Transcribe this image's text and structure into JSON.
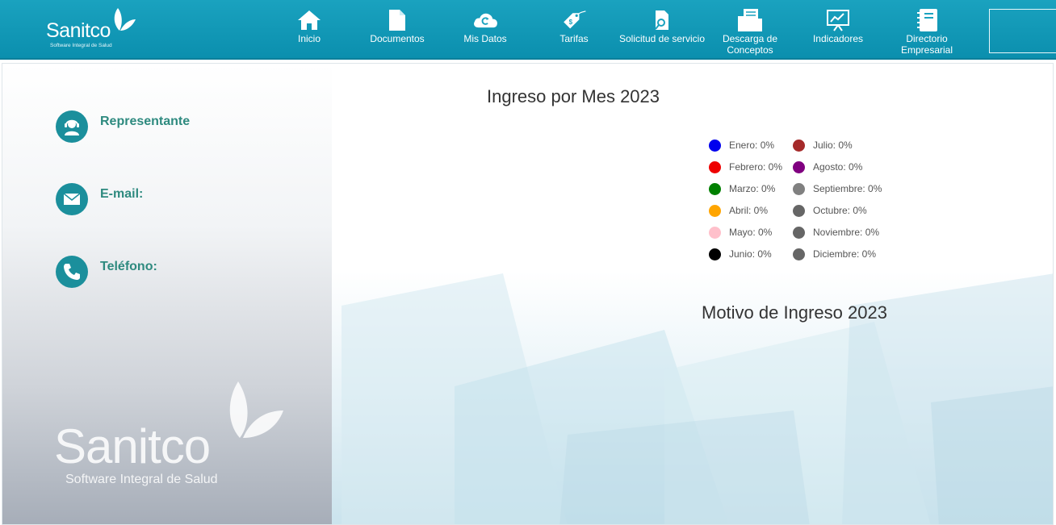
{
  "brand": {
    "name": "Sanitco",
    "tagline": "Software Integral de Salud"
  },
  "nav": {
    "items": [
      {
        "label": "Inicio",
        "icon": "home-icon"
      },
      {
        "label": "Documentos",
        "icon": "document-icon"
      },
      {
        "label": "Mis Datos",
        "icon": "cloud-refresh-icon"
      },
      {
        "label": "Tarifas",
        "icon": "price-tag-icon"
      },
      {
        "label": "Solicitud de servicio",
        "icon": "document-search-icon"
      },
      {
        "label": "Descarga de Conceptos",
        "icon": "folder-download-icon"
      },
      {
        "label": "Indicadores",
        "icon": "presentation-chart-icon"
      },
      {
        "label": "Directorio Empresarial",
        "icon": "notebook-icon"
      }
    ]
  },
  "contact": {
    "representante_label": "Representante",
    "email_label": "E-mail:",
    "telefono_label": "Teléfono:"
  },
  "charts": {
    "monthly_title": "Ingreso por Mes 2023",
    "reason_title": "Motivo de Ingreso 2023"
  },
  "chart_data": {
    "type": "pie",
    "title": "Ingreso por Mes 2023",
    "categories": [
      "Enero",
      "Febrero",
      "Marzo",
      "Abril",
      "Mayo",
      "Junio",
      "Julio",
      "Agosto",
      "Septiembre",
      "Octubre",
      "Noviembre",
      "Diciembre"
    ],
    "values": [
      0,
      0,
      0,
      0,
      0,
      0,
      0,
      0,
      0,
      0,
      0,
      0
    ],
    "legend": [
      {
        "label": "Enero: 0%",
        "color": "#0000ee"
      },
      {
        "label": "Febrero: 0%",
        "color": "#ee0000"
      },
      {
        "label": "Marzo: 0%",
        "color": "#008000"
      },
      {
        "label": "Abril: 0%",
        "color": "#ffa500"
      },
      {
        "label": "Mayo: 0%",
        "color": "#ffc0cb"
      },
      {
        "label": "Junio: 0%",
        "color": "#000000"
      },
      {
        "label": "Julio: 0%",
        "color": "#a52a2a"
      },
      {
        "label": "Agosto: 0%",
        "color": "#800080"
      },
      {
        "label": "Septiembre: 0%",
        "color": "#808080"
      },
      {
        "label": "Octubre: 0%",
        "color": "#666666"
      },
      {
        "label": "Noviembre: 0%",
        "color": "#666666"
      },
      {
        "label": "Diciembre: 0%",
        "color": "#666666"
      }
    ],
    "legend_placement": "right"
  },
  "colors": {
    "nav_bg": "#1aa2bf",
    "accent": "#1b8f9c",
    "contact_text": "#2e8a7f"
  }
}
